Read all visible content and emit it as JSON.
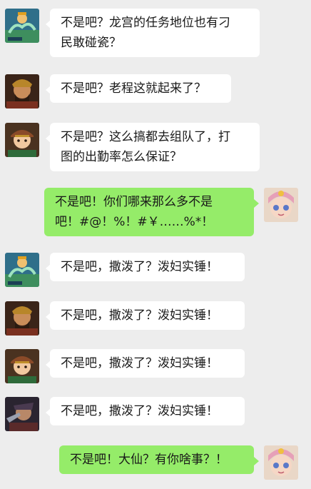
{
  "colors": {
    "background": "#ededed",
    "incoming_bubble": "#ffffff",
    "outgoing_bubble": "#95ec69",
    "text": "#191919"
  },
  "messages": [
    {
      "side": "left",
      "avatar": "avatar-dragon-palace",
      "text": "不是吧？龙宫的任务地位也有刁\n民敢碰瓷？"
    },
    {
      "side": "left",
      "avatar": "avatar-old-cheng",
      "text": "不是吧？老程这就起来了？"
    },
    {
      "side": "left",
      "avatar": "avatar-boy-hat",
      "text": "不是吧？这么搞都去组队了，打\n图的出勤率怎么保证？"
    },
    {
      "side": "right",
      "avatar": "avatar-pink-hair",
      "text": "不是吧！你们哪来那么多不是\n吧！#@！%！#￥……%*！"
    },
    {
      "side": "left",
      "avatar": "avatar-dragon-palace",
      "text": "不是吧，撒泼了？泼妇实锤！"
    },
    {
      "side": "left",
      "avatar": "avatar-old-cheng",
      "text": "不是吧，撒泼了？泼妇实锤！"
    },
    {
      "side": "left",
      "avatar": "avatar-boy-hat",
      "text": "不是吧，撒泼了？泼妇实锤！"
    },
    {
      "side": "left",
      "avatar": "avatar-dark-warrior",
      "text": "不是吧，撒泼了？泼妇实锤！"
    },
    {
      "side": "right",
      "avatar": "avatar-pink-hair",
      "text": "不是吧！大仙？有你啥事？！"
    }
  ]
}
